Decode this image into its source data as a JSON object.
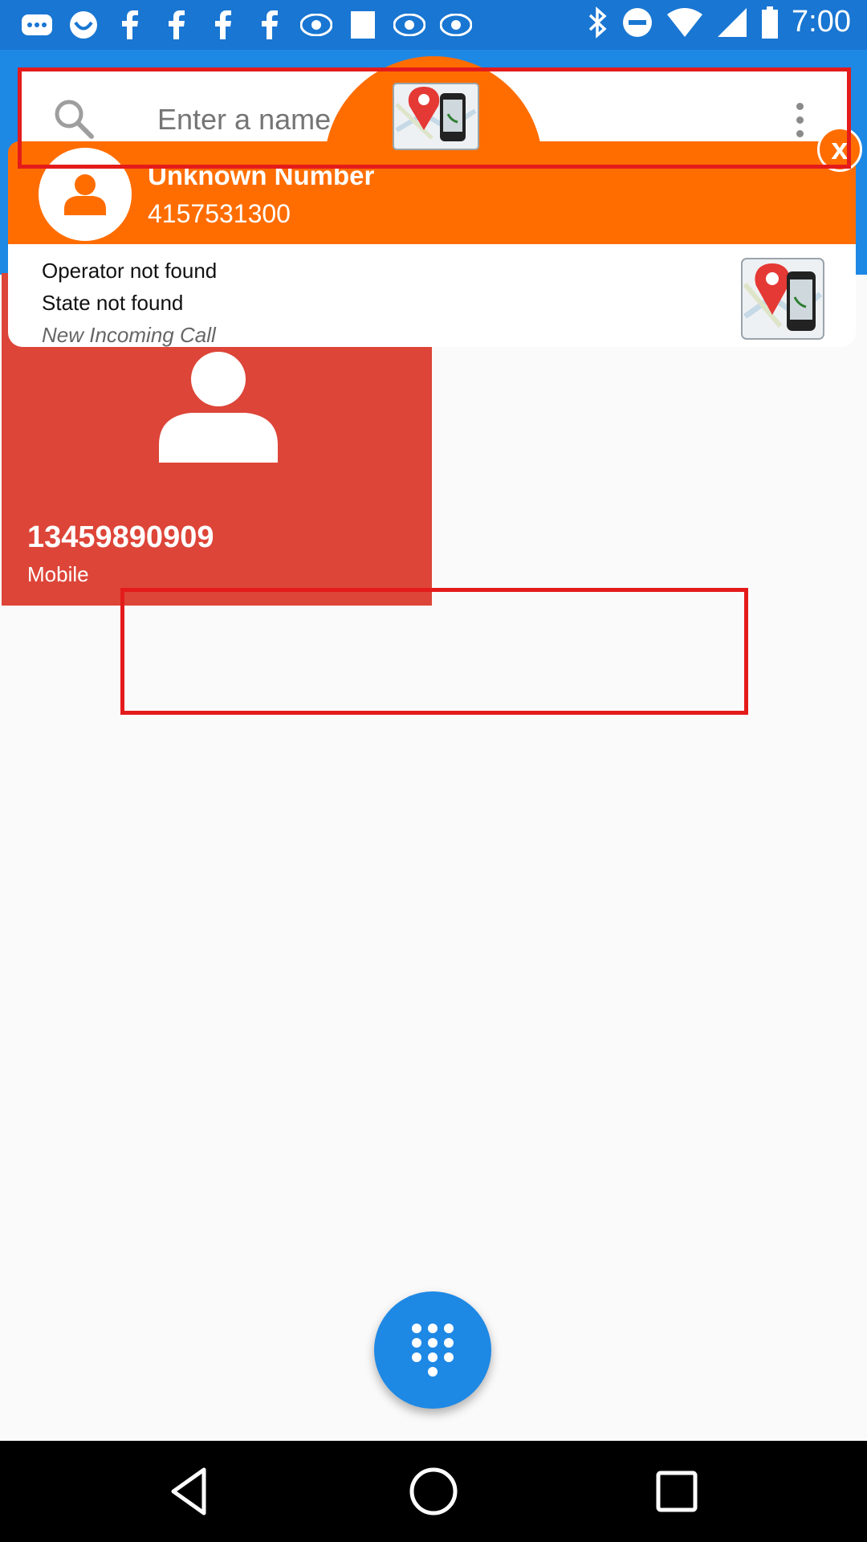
{
  "status_bar": {
    "time": "7:00",
    "icons": [
      "messages-icon",
      "app-icon",
      "facebook-icon",
      "facebook-icon",
      "facebook-icon",
      "facebook-icon",
      "abc13-icon",
      "square-icon",
      "abc13-icon",
      "abc13-icon",
      "bluetooth-icon",
      "dnd-icon",
      "wifi-icon",
      "signal-icon",
      "battery-icon"
    ]
  },
  "search": {
    "placeholder": "Enter a name or number"
  },
  "contact": {
    "number": "13459890909",
    "type": "Mobile",
    "color": "#dd4538"
  },
  "overlay": {
    "caller_name": "Unknown Number",
    "caller_number": "4157531300",
    "operator": "Operator not found",
    "state": "State not found",
    "status": "New Incoming Call",
    "accent": "#ff6d00",
    "close_label": "x"
  },
  "colors": {
    "primary": "#1e88e5",
    "status_bar": "#1976d2",
    "annotation": "#e41b1b"
  }
}
